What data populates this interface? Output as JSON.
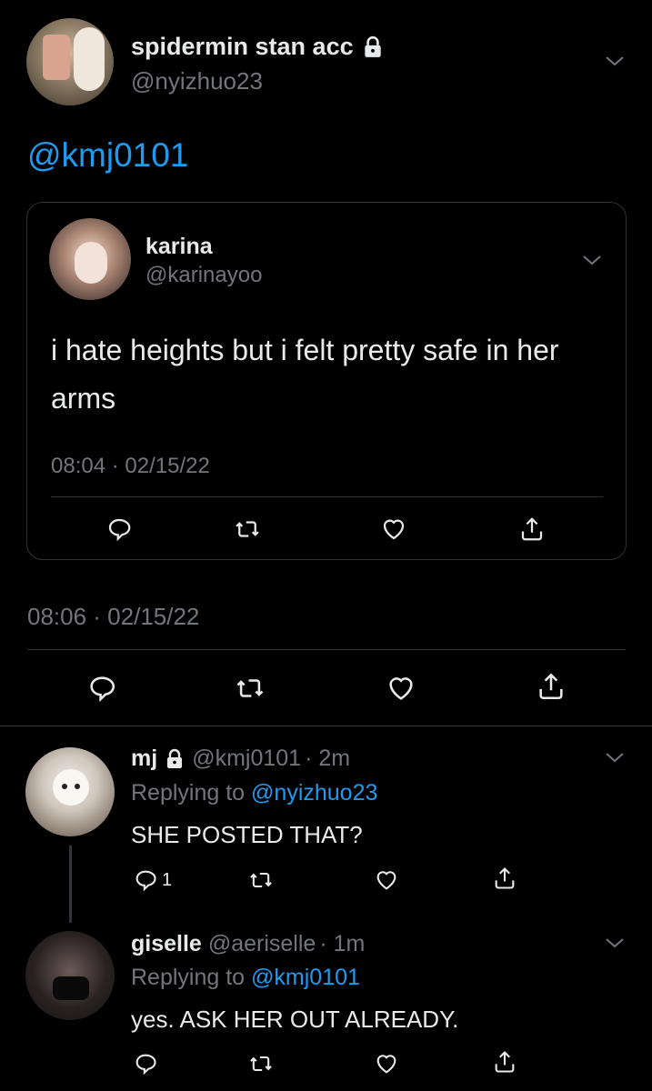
{
  "main_tweet": {
    "display_name": "spidermin stan acc",
    "handle": "@nyizhuo23",
    "text": "@kmj0101",
    "timestamp": "08:06 · 02/15/22",
    "quoted": {
      "display_name": "karina",
      "handle": "@karinayoo",
      "text": "i hate heights but i felt pretty safe in her arms",
      "timestamp": "08:04 · 02/15/22"
    }
  },
  "replies": [
    {
      "display_name": "mj",
      "handle": "@kmj0101",
      "time": "· 2m",
      "replying_prefix": "Replying to",
      "replying_to": "@nyizhuo23",
      "text": "SHE POSTED THAT?",
      "reply_count": "1"
    },
    {
      "display_name": "giselle",
      "handle": "@aeriselle",
      "time": "· 1m",
      "replying_prefix": "Replying to",
      "replying_to": "@kmj0101",
      "text": "yes. ASK HER OUT ALREADY."
    }
  ],
  "icons": [
    "lock-icon",
    "chevron-down-icon",
    "reply-icon",
    "retweet-icon",
    "like-icon",
    "share-icon"
  ],
  "colors": {
    "background": "#000000",
    "text": "#e7e9ea",
    "muted": "#71767b",
    "link": "#1d9bf0",
    "divider": "#2f3336"
  }
}
